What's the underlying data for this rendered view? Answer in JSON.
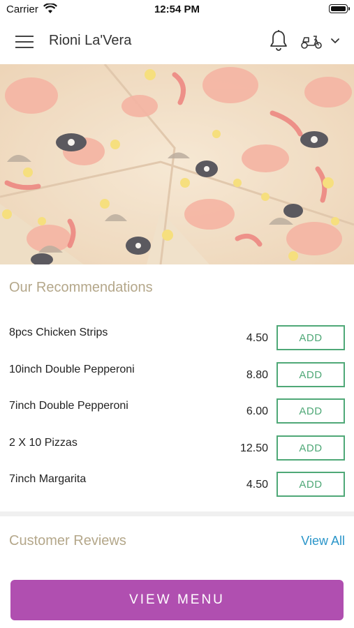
{
  "status_bar": {
    "carrier": "Carrier",
    "time": "12:54 PM"
  },
  "header": {
    "store_name": "Rioni La'Vera"
  },
  "recommendations": {
    "title": "Our Recommendations",
    "add_label": "ADD",
    "items": [
      {
        "name": "8pcs Chicken Strips",
        "price": "4.50"
      },
      {
        "name": "10inch Double Pepperoni",
        "price": "8.80"
      },
      {
        "name": "7inch Double Pepperoni",
        "price": "6.00"
      },
      {
        "name": "2 X 10 Pizzas",
        "price": "12.50"
      },
      {
        "name": "7inch Margarita",
        "price": "4.50"
      }
    ]
  },
  "reviews": {
    "title": "Customer Reviews",
    "view_all_label": "View All"
  },
  "footer": {
    "view_menu_label": "VIEW MENU"
  },
  "colors": {
    "accent_purple": "#b04fb0",
    "add_green": "#4fa877",
    "section_title": "#b4a78a",
    "link_blue": "#2a95c9"
  },
  "icons": [
    "wifi-icon",
    "battery-icon",
    "menu-icon",
    "bell-icon",
    "scooter-icon",
    "chevron-down-icon"
  ]
}
